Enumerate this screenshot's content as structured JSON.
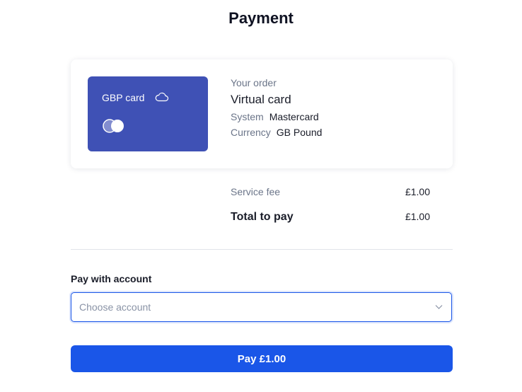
{
  "header": {
    "title": "Payment"
  },
  "card": {
    "name": "GBP card",
    "color": "#3f51b5",
    "cloud_icon": "cloud-icon",
    "brand_icon": "mastercard-icon"
  },
  "order": {
    "label": "Your order",
    "product": "Virtual card",
    "details": [
      {
        "key": "System",
        "value": "Mastercard"
      },
      {
        "key": "Currency",
        "value": "GB Pound"
      }
    ]
  },
  "summary": {
    "service_fee_label": "Service fee",
    "service_fee_value": "£1.00",
    "total_label": "Total to pay",
    "total_value": "£1.00"
  },
  "payment": {
    "account_label": "Pay with account",
    "account_placeholder": "Choose account",
    "pay_button_label": "Pay £1.00",
    "accent_color": "#1a56e8"
  }
}
